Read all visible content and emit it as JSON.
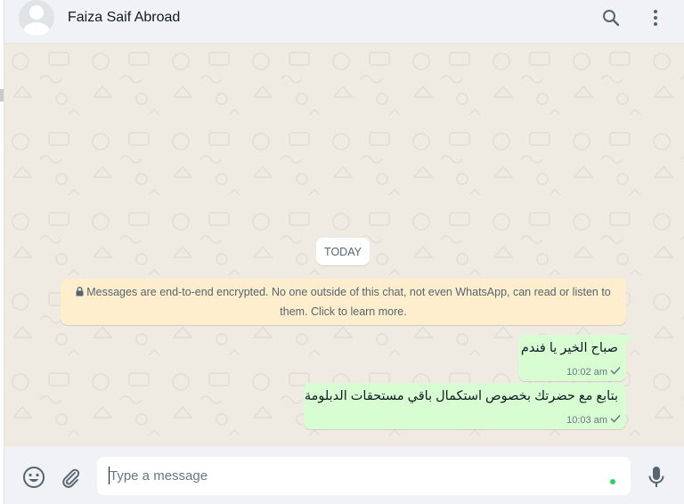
{
  "header": {
    "contact_name": "Faiza Saif Abroad",
    "icons": [
      "search-icon",
      "menu-icon"
    ]
  },
  "chat": {
    "date_chip": "TODAY",
    "encryption_notice": "Messages are end-to-end encrypted. No one outside of this chat, not even WhatsApp, can read or listen to them. Click to learn more.",
    "messages": [
      {
        "text": "صباح الخير يا فندم",
        "time": "10:02 am",
        "status": "sent"
      },
      {
        "text": "بتابع مع حضرتك بخصوص استكمال باقي مستحقات الدبلومة",
        "time": "10:03 am",
        "status": "sent"
      }
    ]
  },
  "composer": {
    "placeholder": "Type a message",
    "value": "",
    "icons": [
      "emoji-icon",
      "attach-icon",
      "mic-icon"
    ]
  },
  "colors": {
    "header_bg": "#f0f2f5",
    "chat_bg": "#efeae2",
    "outgoing_bubble": "#d9fdd3",
    "notice_bg": "#ffeecd",
    "accent_green": "#25d366"
  }
}
